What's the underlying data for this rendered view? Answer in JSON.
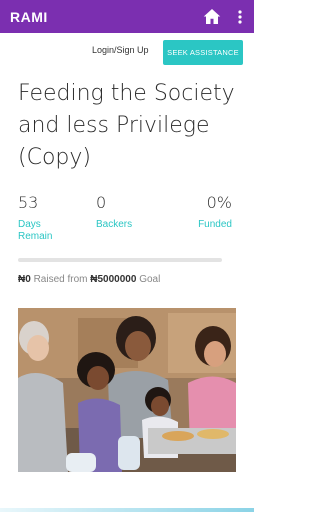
{
  "appbar": {
    "brand": "RAMI",
    "home_icon": "home-icon",
    "menu_icon": "more-vert-icon",
    "color": "#7b2fb0"
  },
  "actions": {
    "login_label": "Login/Sign Up",
    "seek_label": "SEEK ASSISTANCE",
    "accent": "#2bc6c4"
  },
  "campaign": {
    "title": "Feeding the Society and less Privilege (Copy)",
    "stats": [
      {
        "value": "53",
        "label": "Days Remain"
      },
      {
        "value": "0",
        "label": "Backers"
      },
      {
        "value": "0%",
        "label": "Funded"
      }
    ],
    "funded_fraction": 0,
    "raised_amount": "₦0",
    "raised_text": "Raised from",
    "goal_amount": "₦5000000",
    "goal_text": "Goal"
  }
}
